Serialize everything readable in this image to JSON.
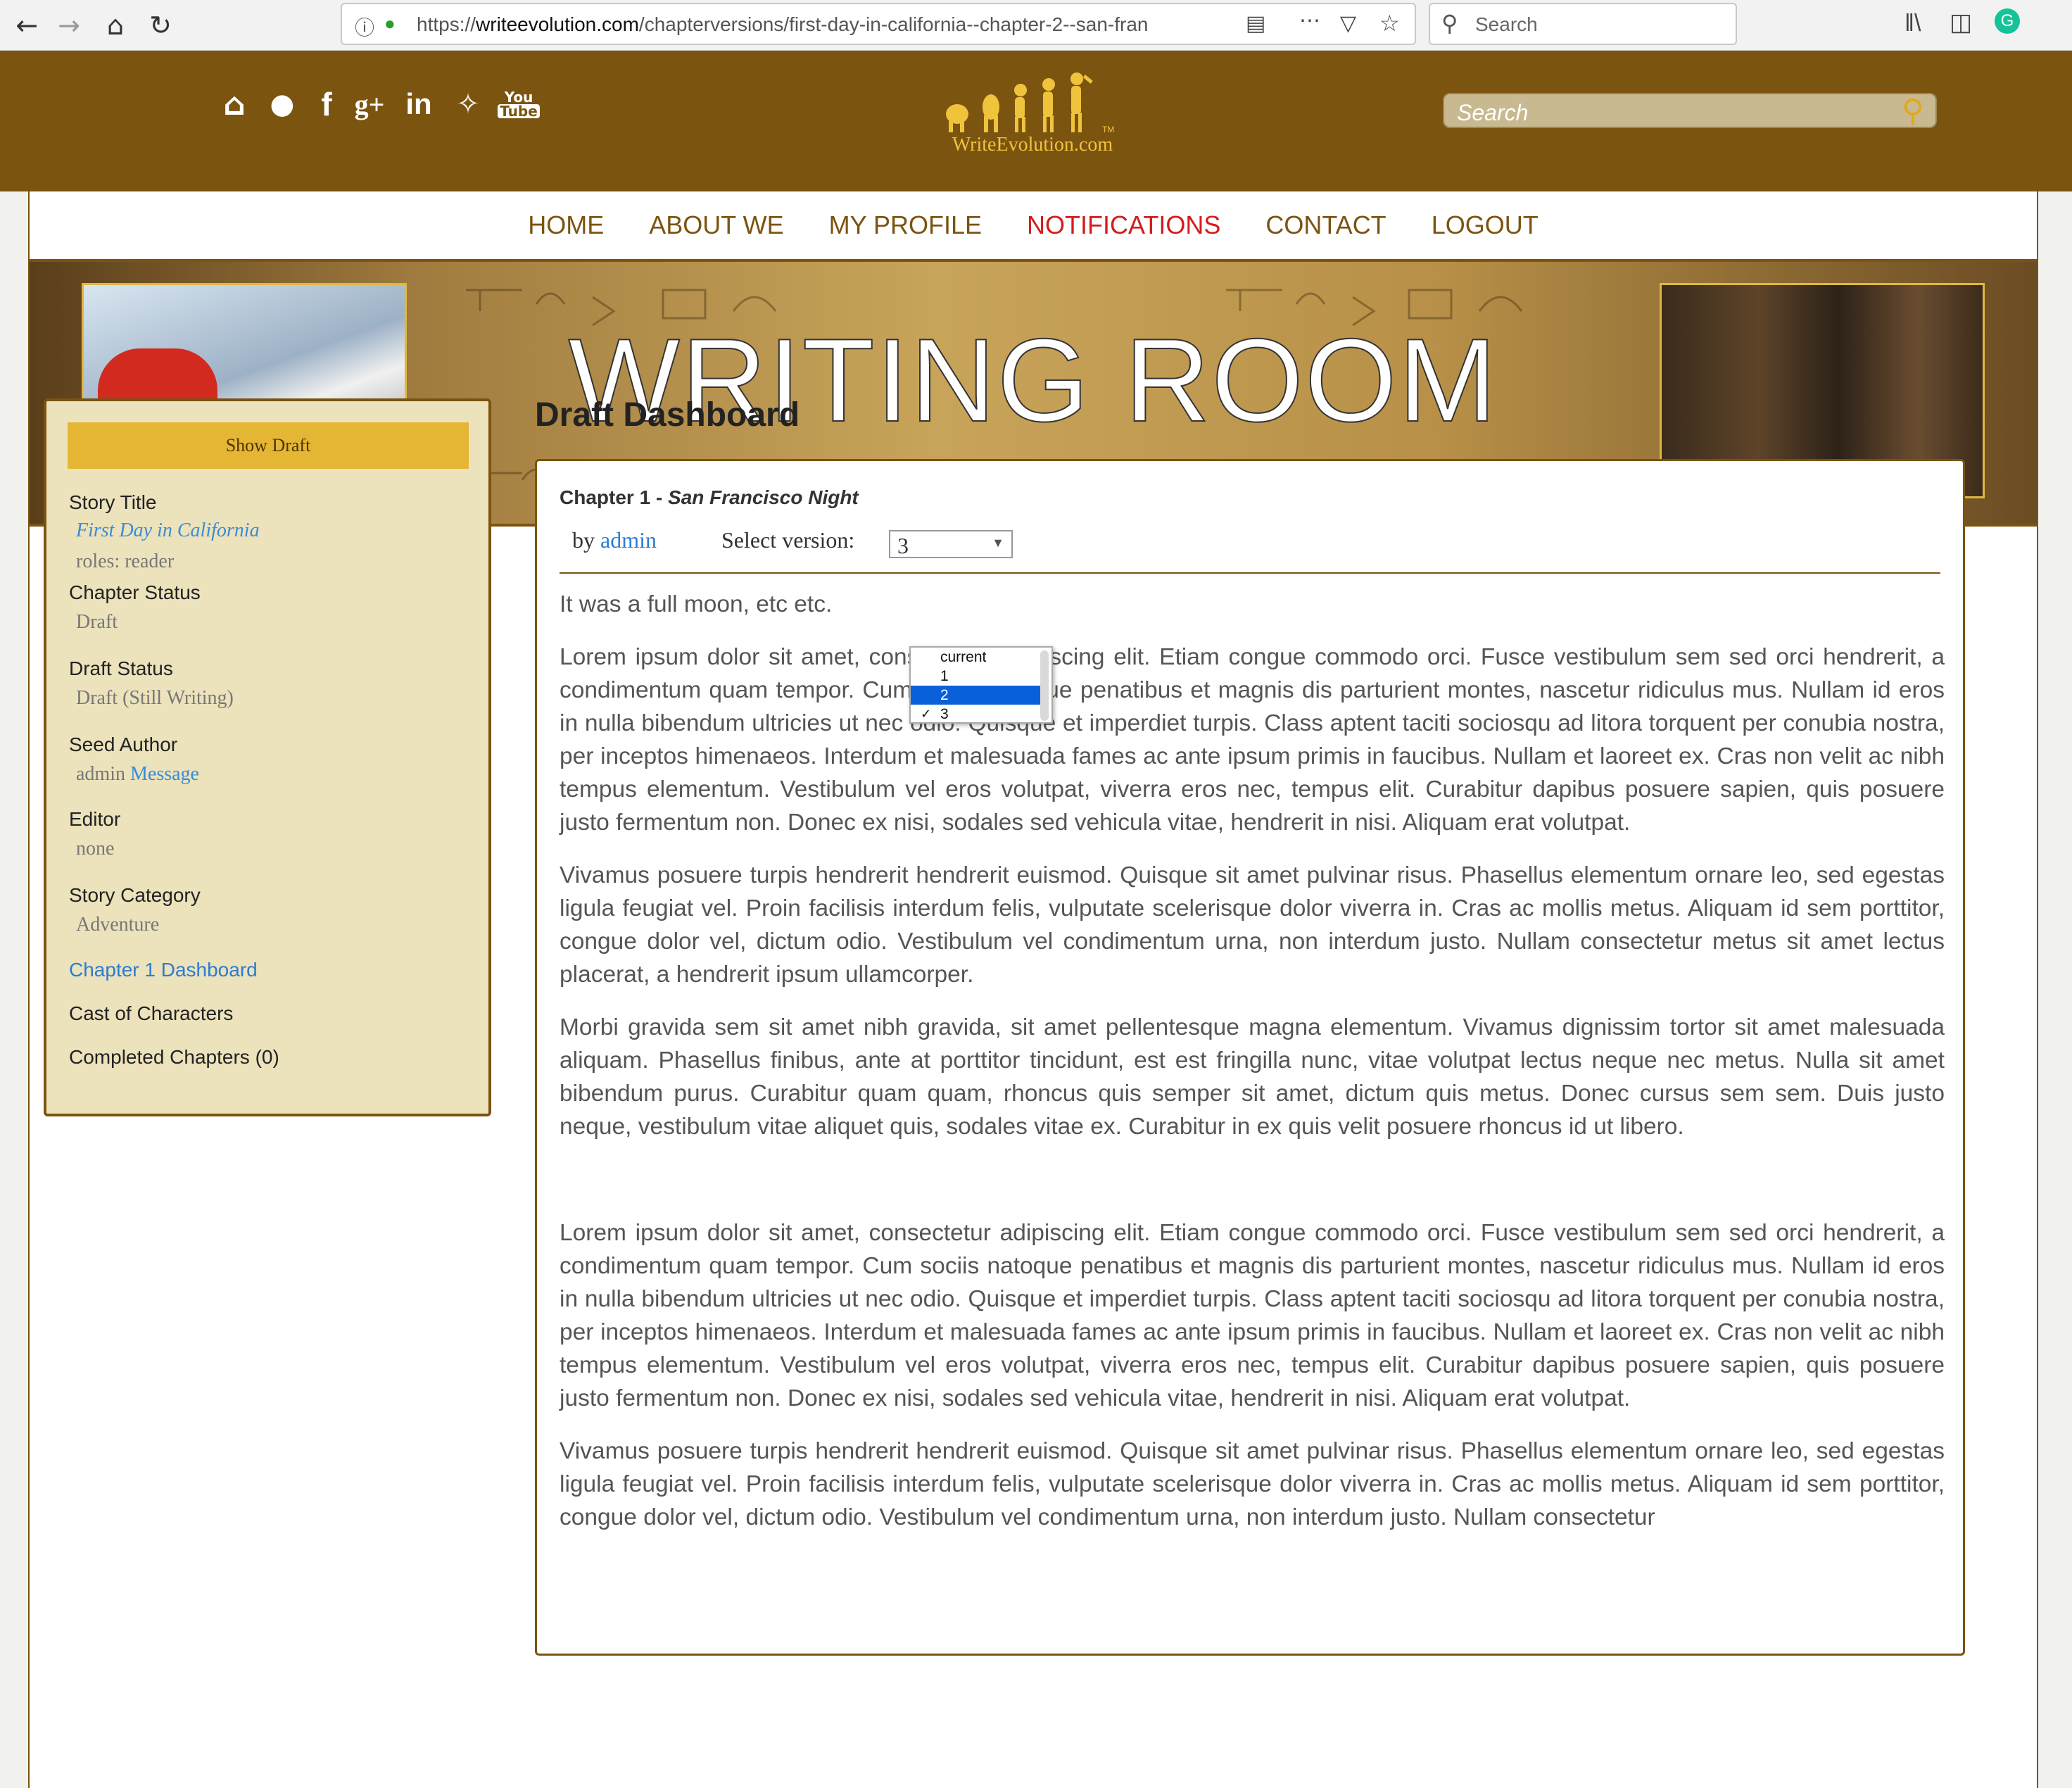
{
  "browser": {
    "url_prefix": "https://",
    "url_host": "writeevolution.com",
    "url_path": "/chapterversions/first-day-in-california--chapter-2--san-fran",
    "search_placeholder": "Search",
    "icons": [
      "back-arrow-icon",
      "forward-arrow-icon",
      "home-icon",
      "reload-icon",
      "info-icon",
      "lock-icon",
      "reader-icon",
      "more-icon",
      "pocket-icon",
      "bookmark-star-icon",
      "search-icon",
      "library-icon",
      "sidebar-icon",
      "grammarly-icon"
    ]
  },
  "header": {
    "logo_text": "WriteEvolution.com",
    "logo_tm": "TM",
    "search_placeholder": "Search",
    "social_labels": [
      "You",
      "Tube"
    ],
    "colors": {
      "header_bg": "#7b5410",
      "logo_gold": "#f0c33c"
    }
  },
  "nav": {
    "items": [
      {
        "label": "HOME"
      },
      {
        "label": "ABOUT WE"
      },
      {
        "label": "MY PROFILE"
      },
      {
        "label": "NOTIFICATIONS"
      },
      {
        "label": "CONTACT"
      },
      {
        "label": "LOGOUT"
      }
    ],
    "active_color": "#d41c1c"
  },
  "banner": {
    "title": "WRITING ROOM"
  },
  "sidebar": {
    "show_draft": "Show Draft",
    "story_title_label": "Story Title",
    "story_title_value": "First Day in California",
    "roles": "roles: reader",
    "chapter_status_label": "Chapter Status",
    "chapter_status_value": "Draft",
    "draft_status_label": "Draft Status",
    "draft_status_value": "Draft (Still Writing)",
    "seed_author_label": "Seed Author",
    "seed_author_value": "admin",
    "seed_author_message": "Message",
    "editor_label": "Editor",
    "editor_value": "none",
    "story_category_label": "Story Category",
    "story_category_value": "Adventure",
    "chapter_dashboard_link": "Chapter 1 Dashboard",
    "cast_link": "Cast of Characters",
    "completed_link": "Completed Chapters (0)"
  },
  "dashboard": {
    "title": "Draft Dashboard",
    "chapter_prefix": "Chapter 1 - ",
    "chapter_name": "San Francisco Night",
    "by_prefix": "by ",
    "author": "admin",
    "version_label": "Select version:",
    "version_selected": "3",
    "version_options": [
      "current",
      "1",
      "2",
      "3"
    ],
    "version_highlighted": "2",
    "paragraphs": [
      "It was a full moon, etc etc.",
      "Lorem ipsum dolor sit amet, consectetur adipiscing elit. Etiam congue commodo orci. Fusce vestibulum sem sed orci hendrerit, a condimentum quam tempor. Cum sociis natoque penatibus et magnis dis parturient montes, nascetur ridiculus mus. Nullam id eros in nulla bibendum ultricies ut nec odio. Quisque et imperdiet turpis. Class aptent taciti sociosqu ad litora torquent per conubia nostra, per inceptos himenaeos. Interdum et malesuada fames ac ante ipsum primis in faucibus. Nullam et laoreet ex. Cras non velit ac nibh tempus elementum. Vestibulum vel eros volutpat, viverra eros nec, tempus elit. Curabitur dapibus posuere sapien, quis posuere justo fermentum non. Donec ex nisi, sodales sed vehicula vitae, hendrerit in nisi. Aliquam erat volutpat.",
      "Vivamus posuere turpis hendrerit hendrerit euismod. Quisque sit amet pulvinar risus. Phasellus elementum ornare leo, sed egestas ligula feugiat vel. Proin facilisis interdum felis, vulputate scelerisque dolor viverra in. Cras ac mollis metus. Aliquam id sem porttitor, congue dolor vel, dictum odio. Vestibulum vel condimentum urna, non interdum justo. Nullam consectetur metus sit amet lectus placerat, a hendrerit ipsum ullamcorper.",
      "Morbi gravida sem sit amet nibh gravida, sit amet pellentesque magna elementum. Vivamus dignissim tortor sit amet malesuada aliquam. Phasellus finibus, ante at porttitor tincidunt, est est fringilla nunc, vitae volutpat lectus neque nec metus. Nulla sit amet bibendum purus. Curabitur quam quam, rhoncus quis semper sit amet, dictum quis metus. Donec cursus sem sem. Duis justo neque, vestibulum vitae aliquet quis, sodales vitae ex. Curabitur in ex quis velit posuere rhoncus id ut libero.",
      "Lorem ipsum dolor sit amet, consectetur adipiscing elit. Etiam congue commodo orci. Fusce vestibulum sem sed orci hendrerit, a condimentum quam tempor. Cum sociis natoque penatibus et magnis dis parturient montes, nascetur ridiculus mus. Nullam id eros in nulla bibendum ultricies ut nec odio. Quisque et imperdiet turpis. Class aptent taciti sociosqu ad litora torquent per conubia nostra, per inceptos himenaeos. Interdum et malesuada fames ac ante ipsum primis in faucibus. Nullam et laoreet ex. Cras non velit ac nibh tempus elementum. Vestibulum vel eros volutpat, viverra eros nec, tempus elit. Curabitur dapibus posuere sapien, quis posuere justo fermentum non. Donec ex nisi, sodales sed vehicula vitae, hendrerit in nisi. Aliquam erat volutpat.",
      "Vivamus posuere turpis hendrerit hendrerit euismod. Quisque sit amet pulvinar risus. Phasellus elementum ornare leo, sed egestas ligula feugiat vel. Proin facilisis interdum felis, vulputate scelerisque dolor viverra in. Cras ac mollis metus. Aliquam id sem porttitor, congue dolor vel, dictum odio. Vestibulum vel condimentum urna, non interdum justo. Nullam consectetur"
    ]
  }
}
